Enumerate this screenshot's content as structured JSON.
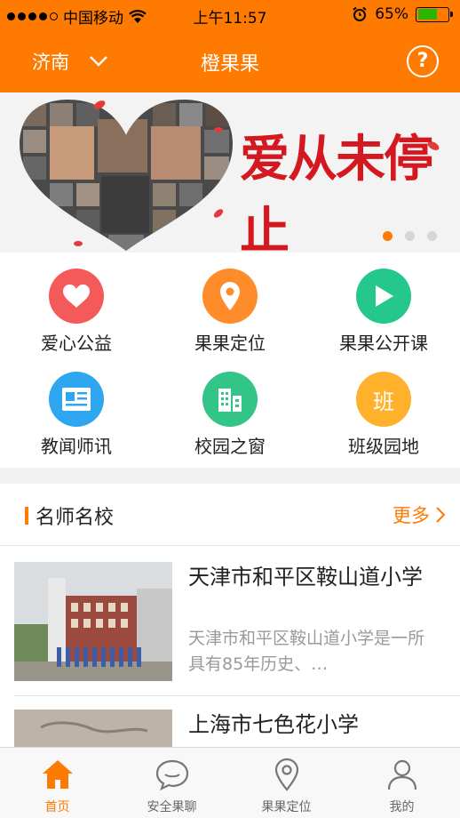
{
  "status_bar": {
    "carrier": "中国移动",
    "time": "上午11:57",
    "battery": "65%"
  },
  "nav": {
    "city": "济南",
    "title": "橙果果",
    "help_icon": "question-circle-icon"
  },
  "banner": {
    "slogan": "爱从未停止",
    "page_count": 3,
    "active_page": 1
  },
  "grid": [
    {
      "label": "爱心公益",
      "icon": "heart-icon",
      "color": "#f45a5a"
    },
    {
      "label": "果果定位",
      "icon": "location-pin-icon",
      "color": "#ff8c2b"
    },
    {
      "label": "果果公开课",
      "icon": "play-icon",
      "color": "#26c78d"
    },
    {
      "label": "教闻师讯",
      "icon": "news-icon",
      "color": "#2fa6f0"
    },
    {
      "label": "校园之窗",
      "icon": "building-icon",
      "color": "#33c488"
    },
    {
      "label": "班级园地",
      "icon": "class-icon",
      "icon_text": "班",
      "color": "#ffb12b"
    }
  ],
  "section": {
    "title": "名师名校",
    "more": "更多",
    "items": [
      {
        "title": "天津市和平区鞍山道小学",
        "desc": "天津市和平区鞍山道小学是一所具有85年历史、…"
      },
      {
        "title": "上海市七色花小学",
        "desc": ""
      }
    ]
  },
  "tabs": [
    {
      "label": "首页",
      "icon": "home-icon",
      "active": true
    },
    {
      "label": "安全果聊",
      "icon": "chat-bubble-icon",
      "active": false
    },
    {
      "label": "果果定位",
      "icon": "location-pin-icon",
      "active": false
    },
    {
      "label": "我的",
      "icon": "person-icon",
      "active": false
    }
  ],
  "colors": {
    "brand": "#ff7a00",
    "banner_red": "#d3191f"
  }
}
